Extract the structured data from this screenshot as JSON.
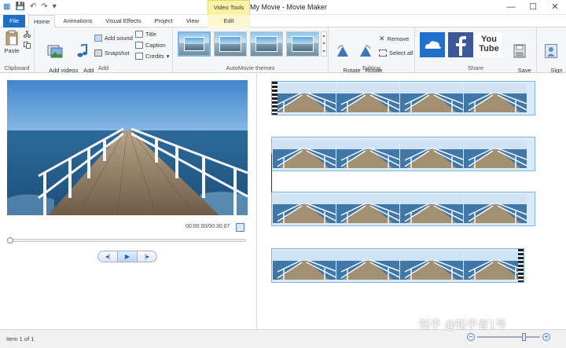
{
  "titlebar": {
    "title": "My Movie - Movie Maker",
    "context_tab": "Video Tools",
    "minimize": "—",
    "maximize": "☐",
    "close": "✕"
  },
  "tabs": [
    "File",
    "Home",
    "Animations",
    "Visual Effects",
    "Project",
    "View",
    "Edit"
  ],
  "ribbon": {
    "clipboard": {
      "label": "Clipboard",
      "paste": "Paste"
    },
    "add": {
      "label": "Add",
      "add_videos": "Add videos\nand photos",
      "add_music": "Add\nmusic",
      "add_sound": "Add sound",
      "snapshot": "Snapshot",
      "title": "Title",
      "caption": "Caption",
      "credits": "Credits"
    },
    "themes": {
      "label": "AutoMovie themes"
    },
    "editing": {
      "label": "Editing",
      "rotate_left": "Rotate\nleft",
      "rotate_right": "Rotate\nright",
      "remove": "Remove",
      "select_all": "Select all"
    },
    "share": {
      "label": "Share",
      "youtube": "You\nTube",
      "save_movie": "Save\nmovie"
    },
    "signin": "Sign\nin"
  },
  "preview": {
    "timecode": "00:00.00/00:30.07"
  },
  "player": {
    "prev": "◂|",
    "play": "▶",
    "next": "|▸"
  },
  "status": {
    "item": "Item 1 of 1"
  },
  "watermark": "知乎 @知乎者1号",
  "zoom": {
    "minus": "−",
    "plus": "+",
    "level": 0.75
  },
  "colors": {
    "accent": "#1e6ec8",
    "context": "#fbf1a9",
    "strip_border": "#7db2e3"
  }
}
